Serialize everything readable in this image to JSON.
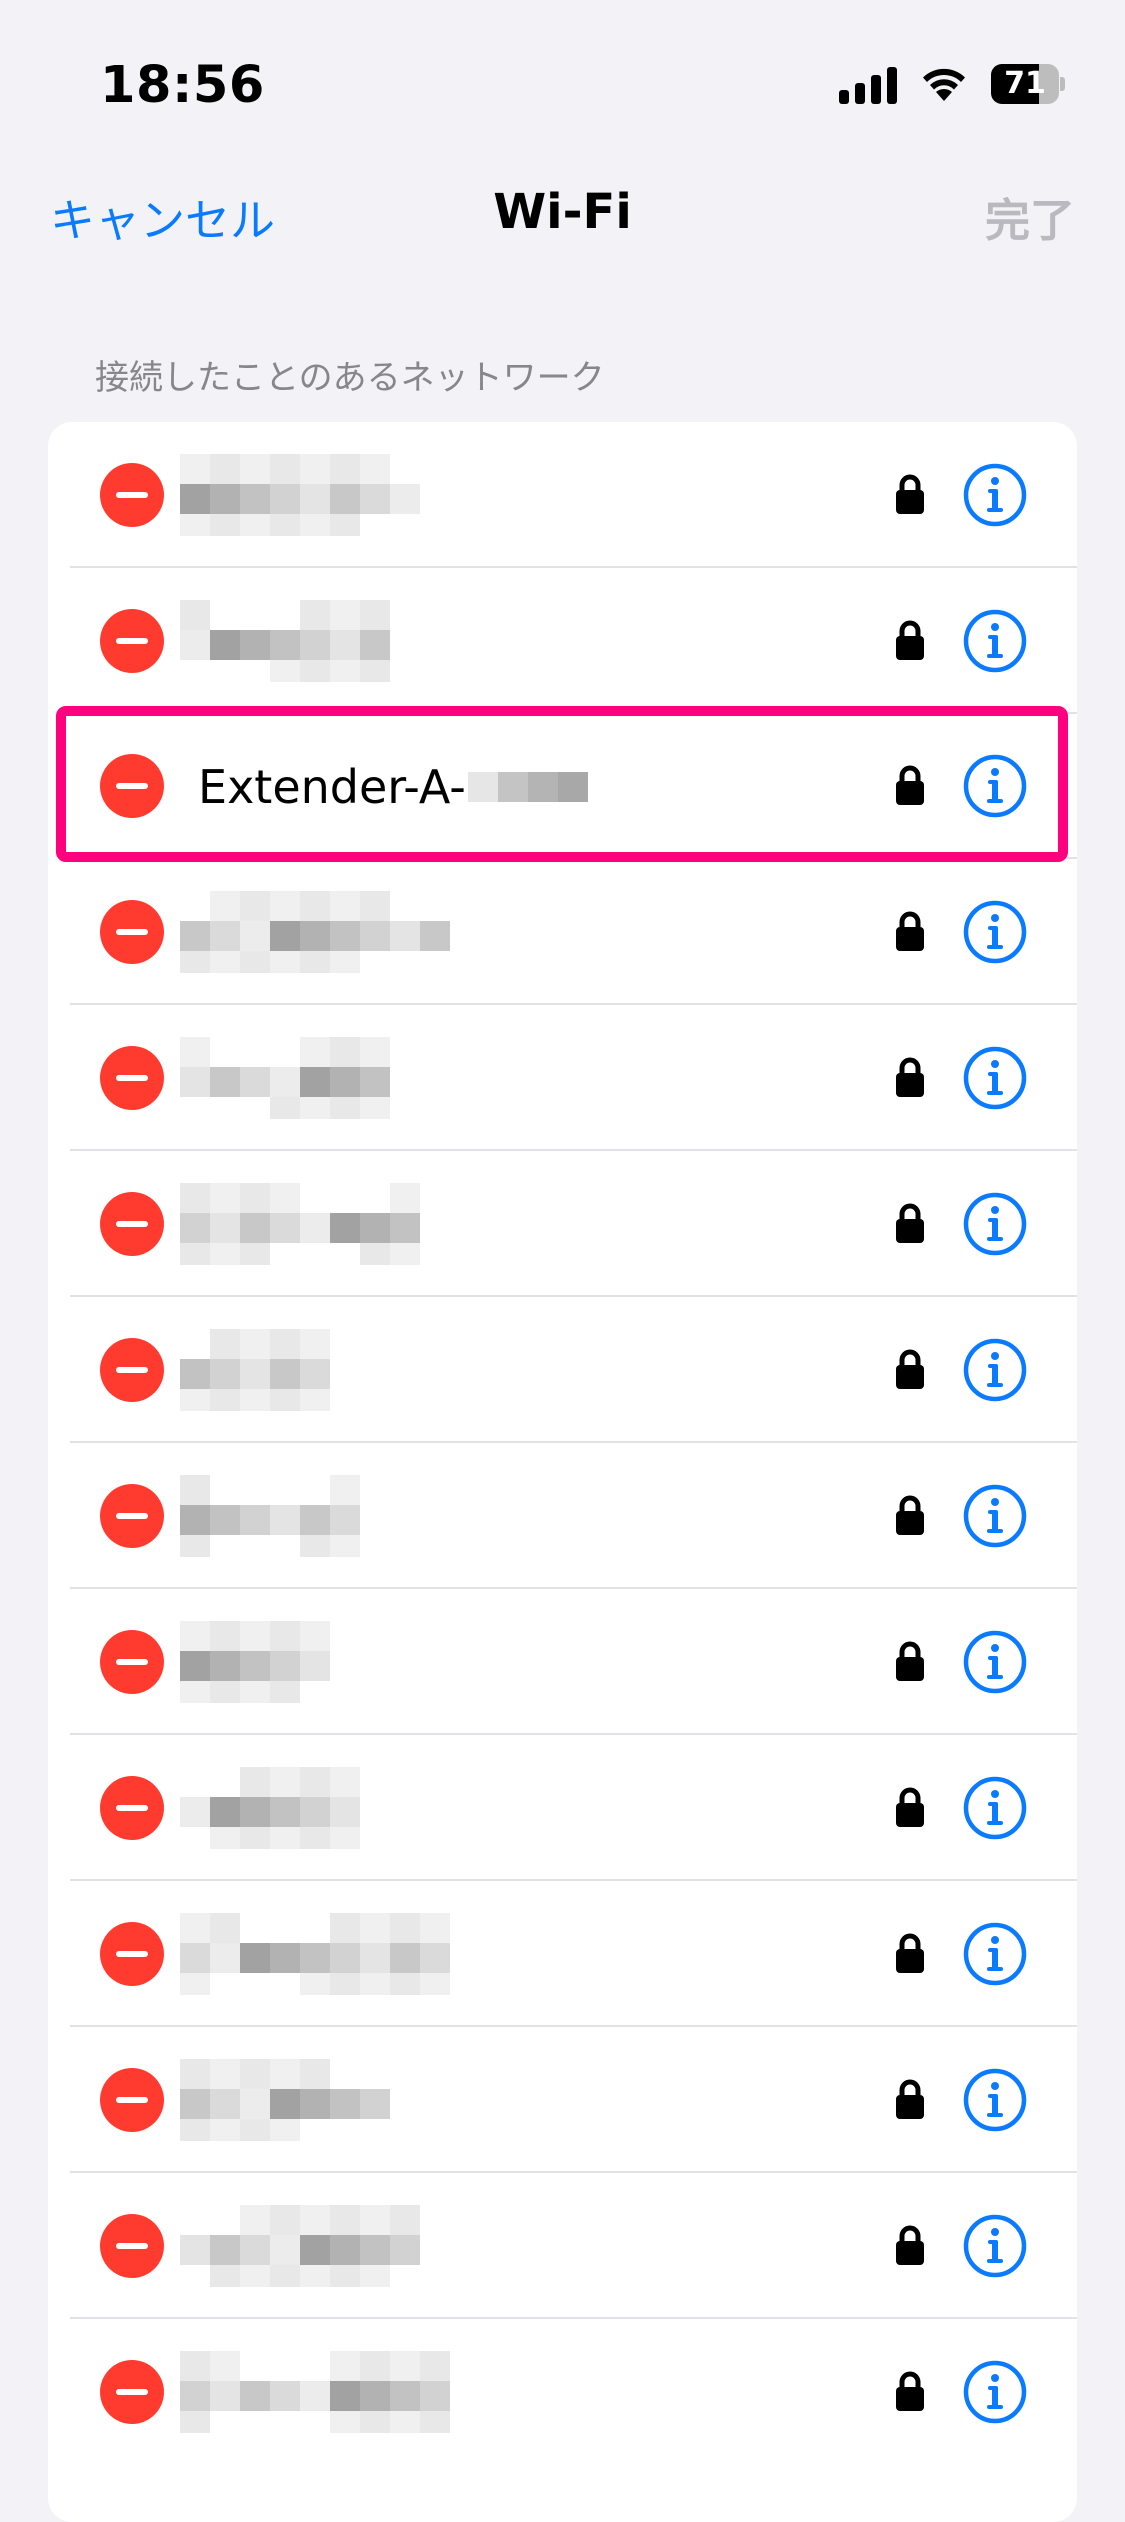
{
  "status_bar": {
    "time": "18:56",
    "battery_level": "71",
    "battery_fraction": 0.71
  },
  "nav": {
    "cancel_label": "キャンセル",
    "title": "Wi-Fi",
    "done_label": "完了"
  },
  "section": {
    "header": "接続したことのあるネットワーク"
  },
  "networks": [
    {
      "ssid": "",
      "redacted": true,
      "secured": true
    },
    {
      "ssid": "",
      "redacted": true,
      "secured": true
    },
    {
      "ssid": "Extender-A-",
      "redacted_suffix": true,
      "secured": true,
      "highlighted": true
    },
    {
      "ssid": "",
      "redacted": true,
      "secured": true
    },
    {
      "ssid": "",
      "redacted": true,
      "secured": true
    },
    {
      "ssid": "",
      "redacted": true,
      "secured": true
    },
    {
      "ssid": "",
      "redacted": true,
      "secured": true
    },
    {
      "ssid": "",
      "redacted": true,
      "secured": true
    },
    {
      "ssid": "",
      "redacted": true,
      "secured": true
    },
    {
      "ssid": "",
      "redacted": true,
      "secured": true
    },
    {
      "ssid": "",
      "redacted": true,
      "secured": true
    },
    {
      "ssid": "",
      "redacted": true,
      "secured": true
    },
    {
      "ssid": "",
      "redacted": true,
      "secured": true
    },
    {
      "ssid": "",
      "redacted": true,
      "secured": true
    }
  ],
  "icons": {
    "delete": "minus-circle-icon",
    "lock": "lock-icon",
    "info": "info-circle-icon",
    "signal": "cellular-signal-icon",
    "wifi": "wifi-icon",
    "battery": "battery-icon"
  },
  "colors": {
    "accent": "#0a7aff",
    "delete": "#ff3b30",
    "highlight": "#ff007f",
    "disabled": "#b9b9bf",
    "background": "#f2f2f7"
  }
}
